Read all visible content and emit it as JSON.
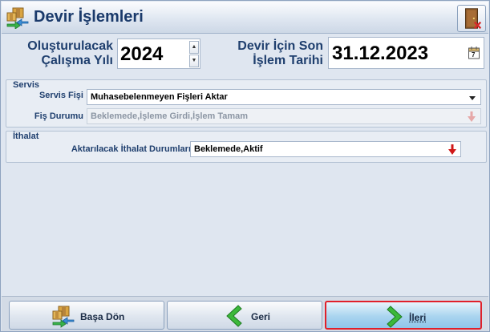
{
  "window": {
    "title": "Devir İşlemleri"
  },
  "header": {
    "year_label_line1": "Oluşturulacak",
    "year_label_line2": "Çalışma Yılı",
    "year_value": "2024",
    "date_label_line1": "Devir İçin Son",
    "date_label_line2": "İşlem Tarihi",
    "date_value": "31.12.2023",
    "calendar_day": "7"
  },
  "servis": {
    "group_title": "Servis",
    "fis_label": "Servis Fişi",
    "fis_value": "Muhasebelenmeyen Fişleri Aktar",
    "durum_label": "Fiş Durumu",
    "durum_value": "Beklemede,İşleme Girdi,İşlem Tamam"
  },
  "ithalat": {
    "group_title": "İthalat",
    "durum_label": "Aktarılacak İthalat Durumları",
    "durum_value": "Beklemede,Aktif"
  },
  "footer": {
    "home_label": "Başa Dön",
    "back_label": "Geri",
    "next_label": "İleri"
  },
  "colors": {
    "accent_border": "#e0202a",
    "label_text": "#1f3f6e",
    "arrow_green": "#3cb83a"
  }
}
